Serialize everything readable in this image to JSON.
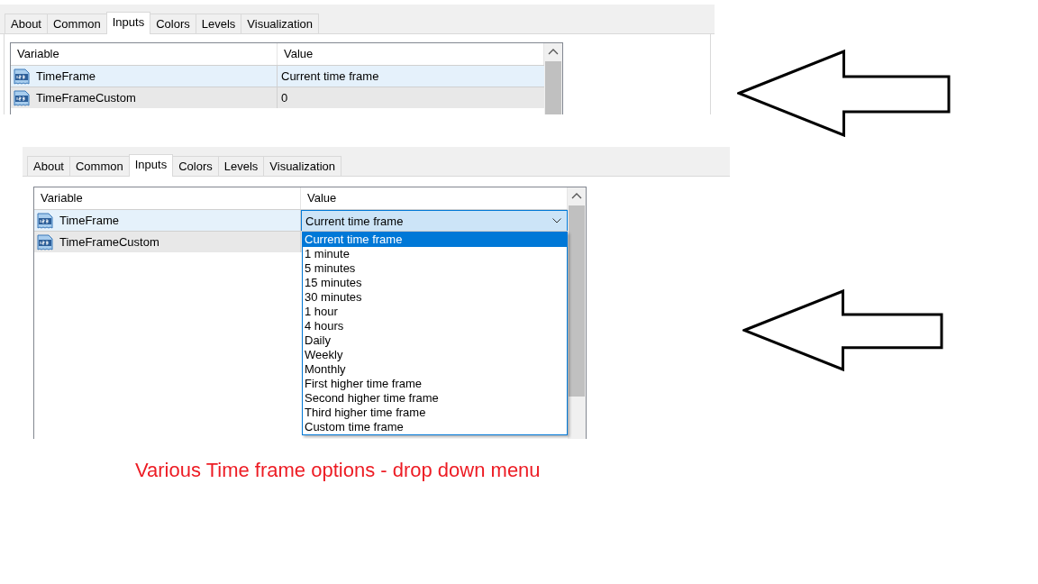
{
  "panels": [
    {
      "tabs": [
        {
          "label": "About",
          "selected": false
        },
        {
          "label": "Common",
          "selected": false
        },
        {
          "label": "Inputs",
          "selected": true
        },
        {
          "label": "Colors",
          "selected": false
        },
        {
          "label": "Levels",
          "selected": false
        },
        {
          "label": "Visualization",
          "selected": false
        }
      ],
      "grid": {
        "columns": [
          "Variable",
          "Value"
        ],
        "rows": [
          {
            "variable": "TimeFrame",
            "value": "Current time frame",
            "selected": true
          },
          {
            "variable": "TimeFrameCustom",
            "value": "0",
            "selected": false
          }
        ]
      }
    },
    {
      "tabs": [
        {
          "label": "About",
          "selected": false
        },
        {
          "label": "Common",
          "selected": false
        },
        {
          "label": "Inputs",
          "selected": true
        },
        {
          "label": "Colors",
          "selected": false
        },
        {
          "label": "Levels",
          "selected": false
        },
        {
          "label": "Visualization",
          "selected": false
        }
      ],
      "grid": {
        "columns": [
          "Variable",
          "Value"
        ],
        "rows": [
          {
            "variable": "TimeFrame",
            "value": "Current time frame",
            "selected": true,
            "dropdown": {
              "expanded": true,
              "options": [
                {
                  "label": "Current time frame",
                  "selected": true
                },
                {
                  "label": "1 minute",
                  "selected": false
                },
                {
                  "label": "5 minutes",
                  "selected": false
                },
                {
                  "label": "15 minutes",
                  "selected": false
                },
                {
                  "label": "30 minutes",
                  "selected": false
                },
                {
                  "label": "1 hour",
                  "selected": false
                },
                {
                  "label": "4 hours",
                  "selected": false
                },
                {
                  "label": "Daily",
                  "selected": false
                },
                {
                  "label": "Weekly",
                  "selected": false
                },
                {
                  "label": "Monthly",
                  "selected": false
                },
                {
                  "label": "First higher time frame",
                  "selected": false
                },
                {
                  "label": "Second higher time frame",
                  "selected": false
                },
                {
                  "label": "Third higher time frame",
                  "selected": false
                },
                {
                  "label": "Custom time frame",
                  "selected": false
                }
              ]
            }
          },
          {
            "variable": "TimeFrameCustom",
            "selected": false
          }
        ]
      }
    }
  ],
  "caption": "Various Time frame options - drop down menu"
}
